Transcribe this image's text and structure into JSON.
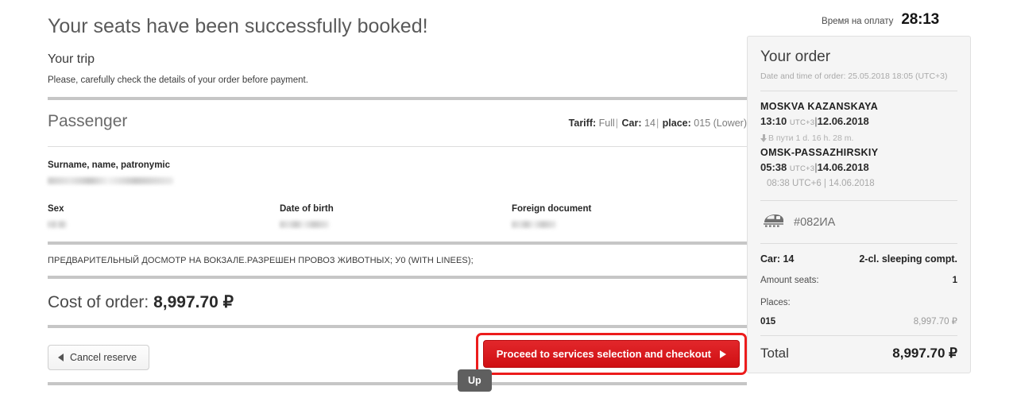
{
  "main": {
    "success_heading": "Your seats have been successfully booked!",
    "trip_heading": "Your trip",
    "trip_note": "Please, carefully check the details of your order before payment.",
    "passenger_heading": "Passenger",
    "tariff": {
      "tariff_label": "Tariff:",
      "tariff_value": "Full",
      "car_label": "Car:",
      "car_value": "14",
      "place_label": "place:",
      "place_value": "015 (Lower)",
      "separator": "|"
    },
    "fields": {
      "fullname_label": "Surname, name, patronymic",
      "fullname_value": "",
      "sex_label": "Sex",
      "sex_value": "",
      "dob_label": "Date of birth",
      "dob_value": "",
      "document_label": "Foreign document",
      "document_value": ""
    },
    "notice": "ПРЕДВАРИТЕЛЬНЫЙ ДОСМОТР НА ВОКЗАЛЕ.РАЗРЕШЕН ПРОВОЗ ЖИВОТНЫХ; У0 (WITH LINEES);",
    "cost_label": "Cost of order:",
    "cost_value": "8,997.70 ₽",
    "cancel_button": "Cancel reserve",
    "proceed_button": "Proceed to services selection and checkout",
    "up_button": "Up",
    "accent_red": "#ec1c1c",
    "button_red": "#cf0f13"
  },
  "sidebar": {
    "timer_label": "Время на оплату",
    "timer_value": "28:13",
    "order_title": "Your order",
    "order_date": "Date and time of order: 25.05.2018 18:05 (UTC+3)",
    "departure": {
      "station": "MOSKVA KAZANSKAYA",
      "time": "13:10",
      "utc": "UTC+3",
      "bar": "|",
      "date": "12.06.2018"
    },
    "duration": "В пути 1 d. 16 h. 28 m.",
    "arrival": {
      "station": "OMSK-PASSAZHIRSKIY",
      "time": "05:38",
      "utc": "UTC+3",
      "bar": "|",
      "date": "14.06.2018",
      "local_line": "08:38 UTC+6 | 14.06.2018"
    },
    "train_number": "#082ИА",
    "car_label": "Car: 14",
    "car_type": "2-cl. sleeping compt.",
    "amount_seats_label": "Amount seats:",
    "amount_seats_value": "1",
    "places_label": "Places:",
    "place_number": "015",
    "place_price": "8,997.70 ₽",
    "total_label": "Total",
    "total_value": "8,997.70 ₽"
  }
}
